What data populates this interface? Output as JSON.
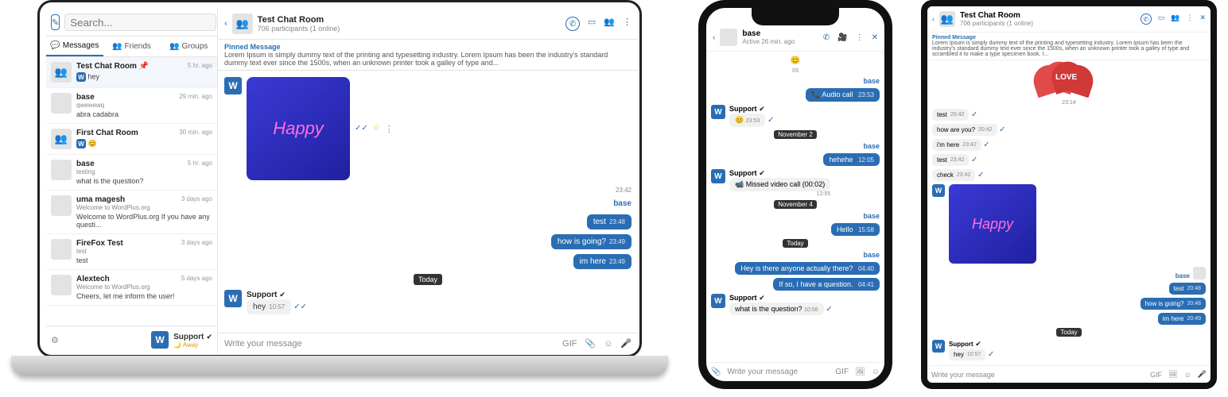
{
  "laptop": {
    "compose_icon": "✎",
    "search_placeholder": "Search...",
    "tabs": {
      "messages": "Messages",
      "friends": "Friends",
      "groups": "Groups"
    },
    "conversations": [
      {
        "name": "Test Chat Room",
        "pin": "📌",
        "time": "5 hr. ago",
        "sub": "",
        "msg": "hey",
        "w": true
      },
      {
        "name": "base",
        "time": "29 min. ago",
        "sub": "qwewewq",
        "msg": "abra cadabra"
      },
      {
        "name": "First Chat Room",
        "time": "30 min. ago",
        "sub": "",
        "msg": "😊",
        "w": true
      },
      {
        "name": "base",
        "time": "5 hr. ago",
        "sub": "testing",
        "msg": "what is the question?"
      },
      {
        "name": "uma magesh",
        "time": "3 days ago",
        "sub": "Welcome to WordPlus.org",
        "msg": "Welcome to WordPlus.org If you have any questi..."
      },
      {
        "name": "FireFox Test",
        "time": "3 days ago",
        "sub": "test",
        "msg": "test"
      },
      {
        "name": "Alextech",
        "time": "5 days ago",
        "sub": "Welcome to WordPlus.org",
        "msg": "Cheers, let me inform the user!"
      }
    ],
    "footer": {
      "gear": "⚙",
      "avatar": "W",
      "name": "Support",
      "verified": "✔",
      "status": "🌙 Away"
    },
    "chat": {
      "title": "Test Chat Room",
      "participants": "706 participants (1 online)",
      "pin_title": "Pinned Message",
      "pin_body": "Lorem Ipsum is simply dummy text of the printing and typesetting industry. Lorem Ipsum has been the industry's standard dummy text ever since the 1500s, when an unknown printer took a galley of type and...",
      "happy": "Happy",
      "happy_time": "23:42",
      "sender_base": "base",
      "out": [
        {
          "text": "test",
          "time": "23:48"
        },
        {
          "text": "how is going?",
          "time": "23:49"
        },
        {
          "text": "im here",
          "time": "23:49"
        }
      ],
      "today": "Today",
      "support_name": "Support",
      "hey": "hey",
      "hey_time": "10:57",
      "input_placeholder": "Write your message"
    }
  },
  "phone": {
    "title": "base",
    "sub": "Active 26 min. ago",
    "time_03": "03",
    "audio_call": "📞  Audio call",
    "audio_time": "23:53",
    "support": "Support",
    "emoji_time": "23:53",
    "date1": "November 2",
    "hehe": "hehehe",
    "hehe_time": "12:05",
    "missed": "📹  Missed video call (00:02)",
    "missed_time": "12:55",
    "date2": "November 4",
    "hello": "Hello",
    "hello_time": "15:58",
    "today": "Today",
    "q1": "Hey is there anyone actually there?",
    "q1_time": "04:40",
    "q2": "If so, I have a question.",
    "q2_time": "04:41",
    "what": "what is the question?",
    "what_time": "10:56",
    "input_placeholder": "Write your message",
    "base": "base"
  },
  "tablet": {
    "title": "Test Chat Room",
    "sub": "706 participants (1 online)",
    "pin_title": "Pinned Message",
    "pin_body": "Lorem Ipsum is simply dummy text of the printing and typesetting industry. Lorem Ipsum has been the industry's standard dummy text ever since the 1500s, when an unknown printer took a galley of type and scrambled it to make a type specimen book. I...",
    "love": "LOVE",
    "time_2314": "23:14",
    "in_msgs": [
      {
        "text": "test",
        "time": "20:42"
      },
      {
        "text": "how are you?",
        "time": "20:42"
      },
      {
        "text": "i'm here",
        "time": "23:42"
      },
      {
        "text": "test",
        "time": "23:42"
      },
      {
        "text": "check",
        "time": "23:42"
      }
    ],
    "happy": "Happy",
    "base": "base",
    "out_msgs": [
      {
        "text": "test",
        "time": "20:48"
      },
      {
        "text": "how is going?",
        "time": "20:48"
      },
      {
        "text": "im here",
        "time": "20:49"
      }
    ],
    "today": "Today",
    "support": "Support",
    "hey": "hey",
    "hey_time": "10:57",
    "input_placeholder": "Write your message"
  }
}
